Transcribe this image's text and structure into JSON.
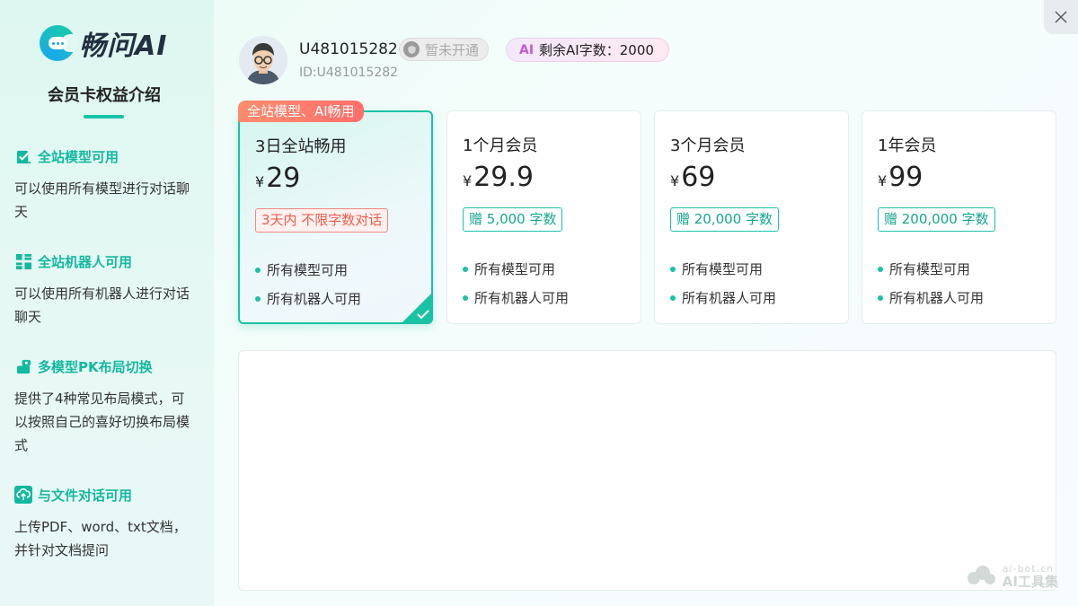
{
  "app": {
    "logo_text": "畅问AI",
    "intro_title": "会员卡权益介绍"
  },
  "features": [
    {
      "icon": "model-check-icon",
      "title": "全站模型可用",
      "desc": "可以使用所有模型进行对话聊天"
    },
    {
      "icon": "robot-grid-icon",
      "title": "全站机器人可用",
      "desc": "可以使用所有机器人进行对话聊天"
    },
    {
      "icon": "layout-switch-icon",
      "title": "多模型PK布局切换",
      "desc": "提供了4种常见布局模式，可以按照自己的喜好切换布局模式"
    },
    {
      "icon": "upload-cloud-icon",
      "title": "与文件对话可用",
      "desc": "上传PDF、word、txt文档，并针对文档提问"
    }
  ],
  "user": {
    "name": "U481015282",
    "id_label": "ID:U481015282",
    "vip_status": "暂未开通",
    "ai_mark": "AI",
    "words_left": "剩余AI字数：2000"
  },
  "plans": [
    {
      "ribbon": "全站模型、AI畅用",
      "name": "3日全站畅用",
      "currency": "¥",
      "price": "29",
      "tag": "3天内 不限字数对话",
      "features": [
        "所有模型可用",
        "所有机器人可用"
      ],
      "selected": true
    },
    {
      "name": "1个月会员",
      "currency": "¥",
      "price": "29.9",
      "tag": "赠 5,000 字数",
      "features": [
        "所有模型可用",
        "所有机器人可用"
      ]
    },
    {
      "name": "3个月会员",
      "currency": "¥",
      "price": "69",
      "tag": "赠 20,000 字数",
      "features": [
        "所有模型可用",
        "所有机器人可用"
      ]
    },
    {
      "name": "1年会员",
      "currency": "¥",
      "price": "99",
      "tag": "赠 200,000 字数",
      "features": [
        "所有模型可用",
        "所有机器人可用"
      ]
    }
  ],
  "watermark": {
    "url": "ai-bot.cn",
    "name": "AI工具集"
  },
  "colors": {
    "accent": "#19c2a4",
    "ribbon": "#ff6f6a",
    "tag_selected": "#ee5d4f"
  }
}
